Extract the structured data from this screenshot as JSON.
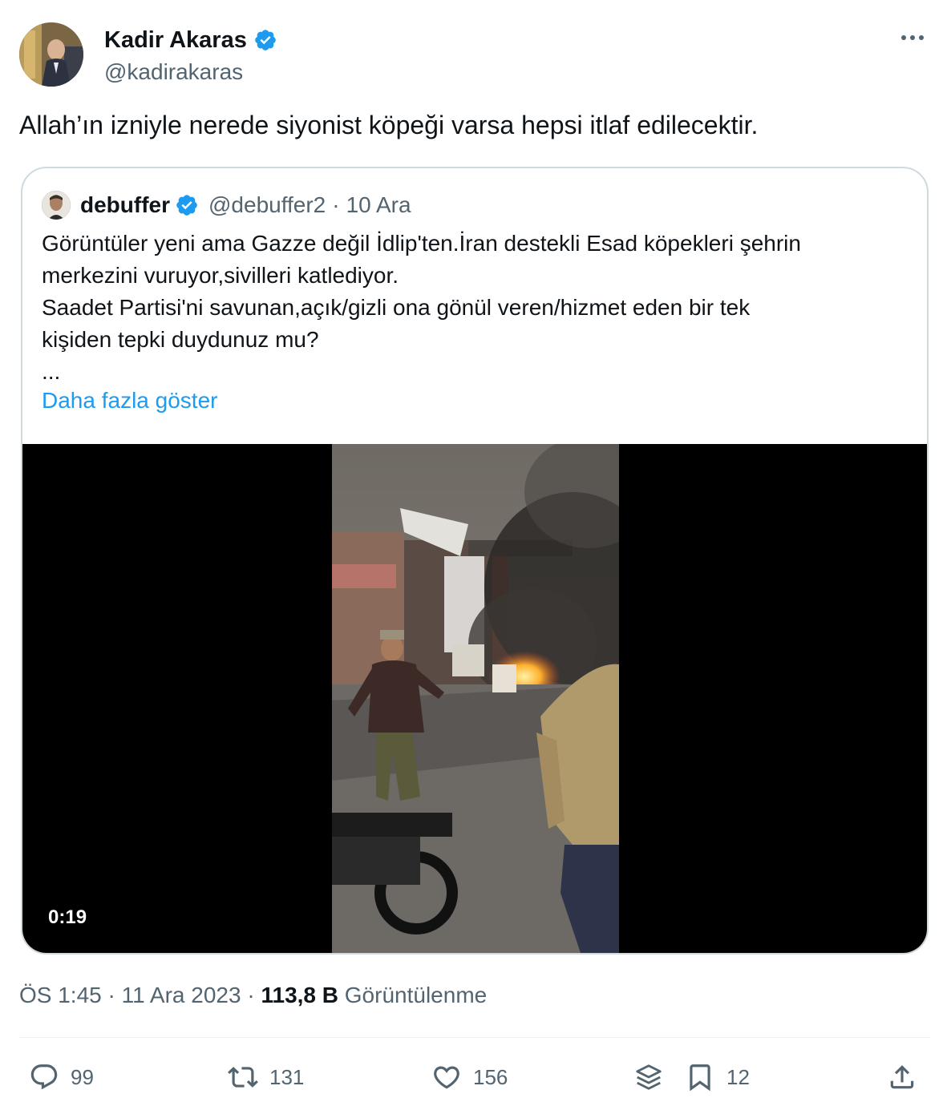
{
  "author": {
    "name": "Kadir Akaras",
    "handle": "@kadirakaras"
  },
  "tweet": {
    "text": "Allah’ın izniyle nerede siyonist köpeği varsa hepsi itlaf edilecektir."
  },
  "quoted": {
    "name": "debuffer",
    "handle": "@debuffer2",
    "separator": "·",
    "date": "10 Ara",
    "lines": [
      "Görüntüler yeni ama Gazze değil İdlip'ten.İran destekli Esad köpekleri şehrin",
      "merkezini vuruyor,sivilleri katlediyor.",
      "Saadet Partisi'ni savunan,açık/gizli ona gönül veren/hizmet eden bir tek",
      "kişiden tepki duydunuz mu?",
      "..."
    ],
    "show_more": "Daha fazla göster",
    "video_duration": "0:19"
  },
  "meta": {
    "time": "ÖS 1:45",
    "sep1": "·",
    "date": "11 Ara 2023",
    "sep2": "·",
    "views_count": "113,8 B",
    "views_label": "Görüntülenme"
  },
  "actions": {
    "replies": "99",
    "retweets": "131",
    "likes": "156",
    "bookmarks": "12"
  },
  "icons": {
    "verified": "verified-badge-icon",
    "more": "more-horizontal-icon",
    "reply": "reply-icon",
    "retweet": "retweet-icon",
    "like": "heart-icon",
    "layers": "layers-icon",
    "bookmark": "bookmark-icon",
    "share": "share-icon"
  },
  "colors": {
    "accent": "#1d9bf0",
    "text": "#0f1419",
    "muted": "#536471",
    "border": "#cfd9de"
  }
}
